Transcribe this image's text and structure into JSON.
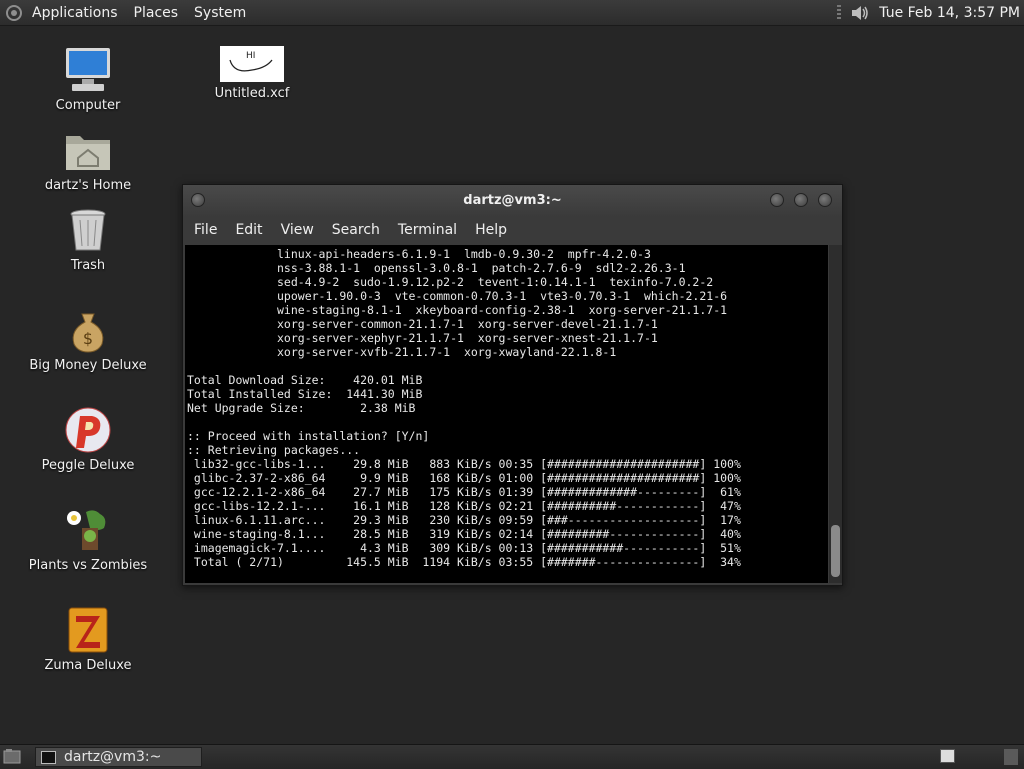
{
  "top_panel": {
    "menus": [
      "Applications",
      "Places",
      "System"
    ],
    "clock": "Tue Feb 14,  3:57 PM"
  },
  "desktop_icons": [
    {
      "label": "Untitled.xcf",
      "icon": "xcf-image-icon"
    },
    {
      "label": "Computer",
      "icon": "computer-icon"
    },
    {
      "label": "dartz's Home",
      "icon": "home-folder-icon"
    },
    {
      "label": "Trash",
      "icon": "trash-icon"
    },
    {
      "label": "Big Money Deluxe",
      "icon": "money-bag-icon"
    },
    {
      "label": "Peggle Deluxe",
      "icon": "peggle-icon"
    },
    {
      "label": "Plants vs Zombies",
      "icon": "plants-icon"
    },
    {
      "label": "Zuma Deluxe",
      "icon": "zuma-icon"
    }
  ],
  "xcf_thumbnail_text": "HI",
  "terminal": {
    "title": "dartz@vm3:~",
    "menu": [
      "File",
      "Edit",
      "View",
      "Search",
      "Terminal",
      "Help"
    ],
    "lines": [
      "             linux-api-headers-6.1.9-1  lmdb-0.9.30-2  mpfr-4.2.0-3",
      "             nss-3.88.1-1  openssl-3.0.8-1  patch-2.7.6-9  sdl2-2.26.3-1",
      "             sed-4.9-2  sudo-1.9.12.p2-2  tevent-1:0.14.1-1  texinfo-7.0.2-2",
      "             upower-1.90.0-3  vte-common-0.70.3-1  vte3-0.70.3-1  which-2.21-6",
      "             wine-staging-8.1-1  xkeyboard-config-2.38-1  xorg-server-21.1.7-1",
      "             xorg-server-common-21.1.7-1  xorg-server-devel-21.1.7-1",
      "             xorg-server-xephyr-21.1.7-1  xorg-server-xnest-21.1.7-1",
      "             xorg-server-xvfb-21.1.7-1  xorg-xwayland-22.1.8-1",
      "",
      "Total Download Size:    420.01 MiB",
      "Total Installed Size:  1441.30 MiB",
      "Net Upgrade Size:        2.38 MiB",
      "",
      ":: Proceed with installation? [Y/n]",
      ":: Retrieving packages...",
      " lib32-gcc-libs-1...    29.8 MiB   883 KiB/s 00:35 [######################] 100%",
      " glibc-2.37-2-x86_64     9.9 MiB   168 KiB/s 01:00 [######################] 100%",
      " gcc-12.2.1-2-x86_64    27.7 MiB   175 KiB/s 01:39 [#############---------]  61%",
      " gcc-libs-12.2.1-...    16.1 MiB   128 KiB/s 02:21 [##########------------]  47%",
      " linux-6.1.11.arc...    29.3 MiB   230 KiB/s 09:59 [###-------------------]  17%",
      " wine-staging-8.1...    28.5 MiB   319 KiB/s 02:14 [#########-------------]  40%",
      " imagemagick-7.1....     4.3 MiB   309 KiB/s 00:13 [###########-----------]  51%",
      " Total ( 2/71)         145.5 MiB  1194 KiB/s 03:55 [#######---------------]  34%"
    ]
  },
  "taskbar": {
    "task_label": "dartz@vm3:~"
  }
}
